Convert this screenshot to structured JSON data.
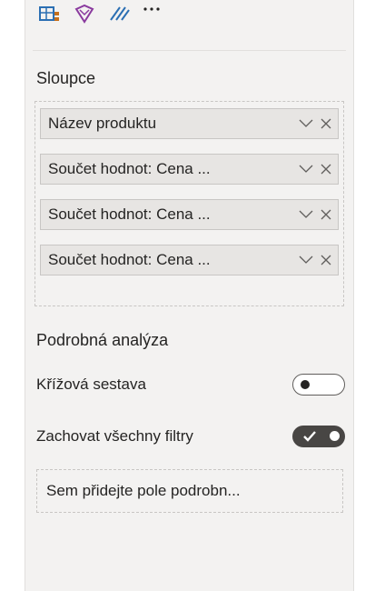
{
  "columns_section": {
    "title": "Sloupce",
    "fields": [
      {
        "label": "Název produktu"
      },
      {
        "label": "Součet hodnot: Cena ..."
      },
      {
        "label": "Součet hodnot: Cena ..."
      },
      {
        "label": "Součet hodnot: Cena ..."
      }
    ]
  },
  "drillthrough": {
    "title": "Podrobná analýza",
    "cross_report": {
      "label": "Křížová sestava",
      "state": "off"
    },
    "keep_all_filters": {
      "label": "Zachovat všechny filtry",
      "state": "on"
    },
    "drop_placeholder": "Sem přidejte pole podrobn..."
  },
  "viz_icons": [
    "matrix-visual-icon",
    "custom-visual-icon",
    "format-icon",
    "more-options-icon"
  ],
  "colors": {
    "panel": "#f3f2f1",
    "accent": "#c66f1b",
    "toggle_on": "#484644"
  }
}
